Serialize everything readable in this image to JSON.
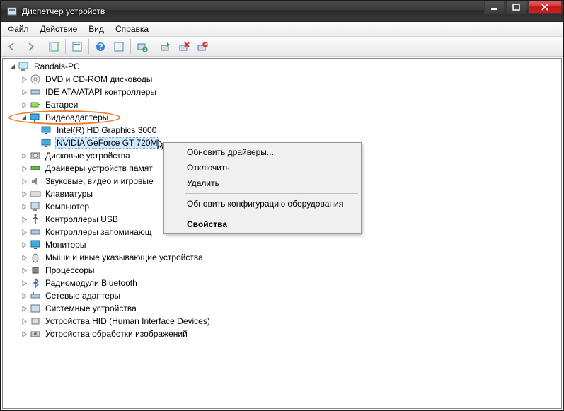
{
  "window": {
    "title": "Диспетчер устройств"
  },
  "menu": {
    "file": "Файл",
    "action": "Действие",
    "view": "Вид",
    "help": "Справка"
  },
  "tree": {
    "root": "Randals-PC",
    "video_category": "Видеоадаптеры",
    "video_item_1": "Intel(R) HD Graphics 3000",
    "video_item_2": "NVIDIA GeForce GT 720M",
    "items": {
      "dvd": "DVD и CD-ROM дисководы",
      "ide": "IDE ATA/ATAPI контроллеры",
      "battery": "Батареи",
      "disk": "Дисковые устройства",
      "memdrv": "Драйверы устройств памят",
      "sound": "Звуковые, видео и игровые",
      "keyboard": "Клавиатуры",
      "computer": "Компьютер",
      "usb": "Контроллеры USB",
      "storage": "Контроллеры запоминающ",
      "monitor": "Мониторы",
      "mouse": "Мыши и иные указывающие устройства",
      "cpu": "Процессоры",
      "bluetooth": "Радиомодули Bluetooth",
      "network": "Сетевые адаптеры",
      "system": "Системные устройства",
      "hid": "Устройства HID (Human Interface Devices)",
      "imaging": "Устройства обработки изображений"
    }
  },
  "context": {
    "update": "Обновить драйверы...",
    "disable": "Отключить",
    "delete": "Удалить",
    "rescan": "Обновить конфигурацию оборудования",
    "props": "Свойства"
  }
}
